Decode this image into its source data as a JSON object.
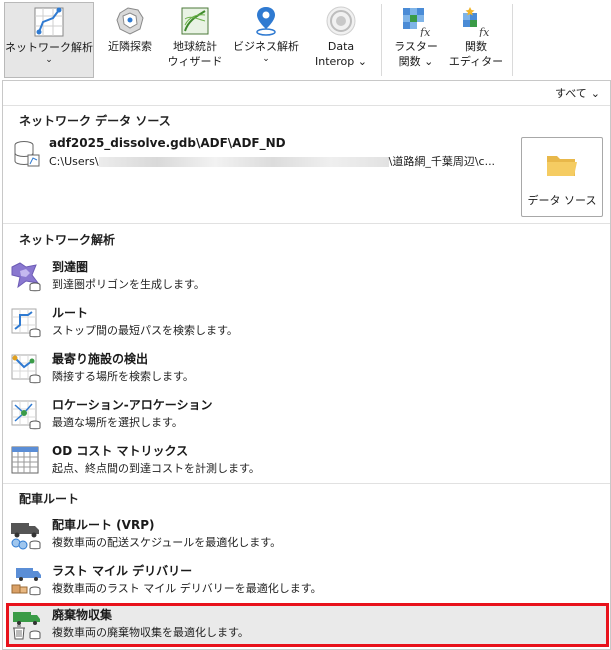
{
  "ribbon": {
    "buttons": [
      {
        "label": "ネットワーク解析",
        "chevron": "⌄",
        "icon": "network-analysis-icon"
      },
      {
        "label": "近隣探索",
        "icon": "proximity-icon"
      },
      {
        "label_line1": "地球統計",
        "label_line2": "ウィザード",
        "icon": "geostatistical-wizard-icon"
      },
      {
        "label": "ビジネス解析",
        "chevron": "⌄",
        "icon": "business-analysis-icon"
      },
      {
        "label_line1": "Data",
        "label_line2": "Interop ⌄",
        "icon": "data-interop-icon"
      },
      {
        "label_line1": "ラスター",
        "label_line2": "関数 ⌄",
        "icon": "raster-functions-icon"
      },
      {
        "label_line1": "関数",
        "label_line2": "エディター",
        "icon": "function-editor-icon"
      }
    ]
  },
  "panel": {
    "filter_label": "すべて",
    "filter_chevron": "⌄",
    "datasource_section": {
      "title": "ネットワーク データ ソース",
      "name": "adf2025_dissolve.gdb\\ADF\\ADF_ND",
      "path_start": "C:\\Users\\",
      "path_end": "\\道路網_千葉周辺\\c...",
      "button_label": "データ ソース"
    },
    "network_section": {
      "title": "ネットワーク解析",
      "items": [
        {
          "title": "到達圏",
          "desc": "到達圏ポリゴンを生成します。",
          "icon": "service-area-icon"
        },
        {
          "title": "ルート",
          "desc": "ストップ間の最短パスを検索します。",
          "icon": "route-icon"
        },
        {
          "title": "最寄り施設の検出",
          "desc": "隣接する場所を検索します。",
          "icon": "closest-facility-icon"
        },
        {
          "title": "ロケーション-アロケーション",
          "desc": "最適な場所を選択します。",
          "icon": "location-allocation-icon"
        },
        {
          "title": "OD コスト マトリックス",
          "desc": "起点、終点間の到達コストを計測します。",
          "icon": "od-cost-matrix-icon"
        }
      ]
    },
    "vehicle_section": {
      "title": "配車ルート",
      "items": [
        {
          "title": "配車ルート (VRP)",
          "desc": "複数車両の配送スケジュールを最適化します。",
          "icon": "vrp-truck-icon"
        },
        {
          "title": "ラスト マイル デリバリー",
          "desc": "複数車両のラスト マイル デリバリーを最適化します。",
          "icon": "last-mile-delivery-icon"
        },
        {
          "title": "廃棄物収集",
          "desc": "複数車両の廃棄物収集を最適化します。",
          "icon": "waste-collection-icon"
        }
      ]
    }
  },
  "colors": {
    "selection_border": "#e8121b",
    "selection_fill": "#eaeaea",
    "accent_blue": "#2f7ad1"
  }
}
